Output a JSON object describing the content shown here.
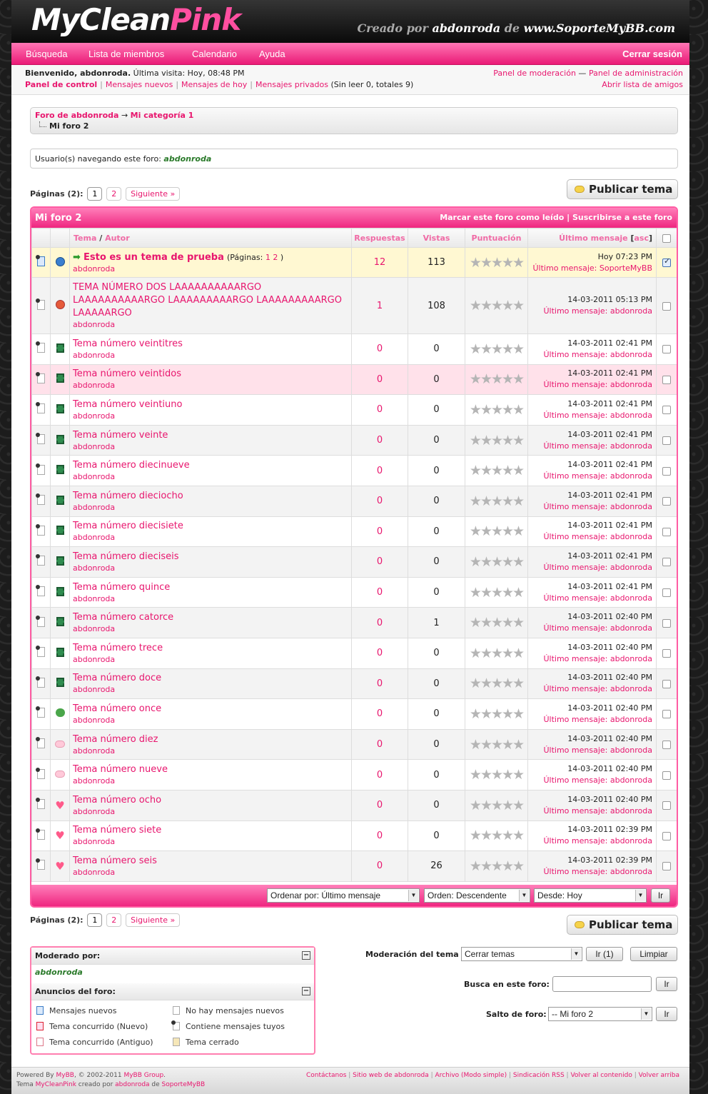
{
  "header": {
    "logo_a": "MyClean",
    "logo_b": "Pink",
    "credit_a": "Creado por ",
    "credit_user": "abdonroda",
    "credit_b": " de ",
    "credit_site": "www.SoporteMyBB.com"
  },
  "menu": {
    "items": [
      "Búsqueda",
      "Lista de miembros",
      "Calendario",
      "Ayuda"
    ],
    "logout": "Cerrar sesión"
  },
  "panel": {
    "welcome": "Bienvenido, abdonroda.",
    "last_visit": " Última visita: Hoy, 08:48 PM",
    "control": "Panel de control",
    "new_posts": "Mensajes nuevos",
    "today": "Mensajes de hoy",
    "pm": "Mensajes privados",
    "pm_counts": " (Sin leer 0, totales 9)",
    "mod_panel": "Panel de moderación",
    "dash": " — ",
    "admin_panel": "Panel de administración",
    "buddy": "Abrir lista de amigos"
  },
  "breadcrumb": {
    "forum": "Foro de abdonroda",
    "arrow": " → ",
    "cat": "Mi categoría 1",
    "current": "Mi foro 2"
  },
  "browsing": {
    "label": "Usuario(s) navegando este foro: ",
    "user": "abdonroda"
  },
  "pagination": {
    "label": "Páginas (2):",
    "p1": "1",
    "p2": "2",
    "next": "Siguiente »"
  },
  "post_button": "Publicar tema",
  "forum": {
    "title": "Mi foro 2",
    "mark_read": "Marcar este foro como leído",
    "sep": " | ",
    "subscribe": "Suscribirse a este foro"
  },
  "columns": {
    "thread": "Tema",
    "slash": " / ",
    "author": "Autor",
    "replies": "Respuestas",
    "views": "Vistas",
    "rating": "Puntuación",
    "last": "Último mensaje",
    "asc": "asc"
  },
  "threads": [
    {
      "title": "Esto es un tema de prueba",
      "pages_prefix": "(Páginas: ",
      "pg1": "1",
      "pg2": "2",
      "pages_suffix": " )",
      "author": "abdonroda",
      "replies": "12",
      "views": "113",
      "date": "Hoy 07:23 PM",
      "last_label": "Último mensaje: ",
      "last_user": "SoporteMyBB"
    },
    {
      "title": "TEMA NÚMERO DOS LAAAAAAAAAARGO LAAAAAAAAAARGO LAAAAAAAAARGO LAAAAAAAAARGO LAAAAARGO",
      "author": "abdonroda",
      "replies": "1",
      "views": "108",
      "date": "14-03-2011 05:13 PM",
      "last_label": "Último mensaje: ",
      "last_user": "abdonroda"
    },
    {
      "title": "Tema número veintitres",
      "author": "abdonroda",
      "replies": "0",
      "views": "0",
      "date": "14-03-2011 02:41 PM",
      "last_label": "Último mensaje: ",
      "last_user": "abdonroda"
    },
    {
      "title": "Tema número veintidos",
      "author": "abdonroda",
      "replies": "0",
      "views": "0",
      "date": "14-03-2011 02:41 PM",
      "last_label": "Último mensaje: ",
      "last_user": "abdonroda"
    },
    {
      "title": "Tema número veintiuno",
      "author": "abdonroda",
      "replies": "0",
      "views": "0",
      "date": "14-03-2011 02:41 PM",
      "last_label": "Último mensaje: ",
      "last_user": "abdonroda"
    },
    {
      "title": "Tema número veinte",
      "author": "abdonroda",
      "replies": "0",
      "views": "0",
      "date": "14-03-2011 02:41 PM",
      "last_label": "Último mensaje: ",
      "last_user": "abdonroda"
    },
    {
      "title": "Tema número diecinueve",
      "author": "abdonroda",
      "replies": "0",
      "views": "0",
      "date": "14-03-2011 02:41 PM",
      "last_label": "Último mensaje: ",
      "last_user": "abdonroda"
    },
    {
      "title": "Tema número dieciocho",
      "author": "abdonroda",
      "replies": "0",
      "views": "0",
      "date": "14-03-2011 02:41 PM",
      "last_label": "Último mensaje: ",
      "last_user": "abdonroda"
    },
    {
      "title": "Tema número diecisiete",
      "author": "abdonroda",
      "replies": "0",
      "views": "0",
      "date": "14-03-2011 02:41 PM",
      "last_label": "Último mensaje: ",
      "last_user": "abdonroda"
    },
    {
      "title": "Tema número dieciseis",
      "author": "abdonroda",
      "replies": "0",
      "views": "0",
      "date": "14-03-2011 02:41 PM",
      "last_label": "Último mensaje: ",
      "last_user": "abdonroda"
    },
    {
      "title": "Tema número quince",
      "author": "abdonroda",
      "replies": "0",
      "views": "0",
      "date": "14-03-2011 02:41 PM",
      "last_label": "Último mensaje: ",
      "last_user": "abdonroda"
    },
    {
      "title": "Tema número catorce",
      "author": "abdonroda",
      "replies": "0",
      "views": "1",
      "date": "14-03-2011 02:40 PM",
      "last_label": "Último mensaje: ",
      "last_user": "abdonroda"
    },
    {
      "title": "Tema número trece",
      "author": "abdonroda",
      "replies": "0",
      "views": "0",
      "date": "14-03-2011 02:40 PM",
      "last_label": "Último mensaje: ",
      "last_user": "abdonroda"
    },
    {
      "title": "Tema número doce",
      "author": "abdonroda",
      "replies": "0",
      "views": "0",
      "date": "14-03-2011 02:40 PM",
      "last_label": "Último mensaje: ",
      "last_user": "abdonroda"
    },
    {
      "title": "Tema número once",
      "author": "abdonroda",
      "replies": "0",
      "views": "0",
      "date": "14-03-2011 02:40 PM",
      "last_label": "Último mensaje: ",
      "last_user": "abdonroda"
    },
    {
      "title": "Tema número diez",
      "author": "abdonroda",
      "replies": "0",
      "views": "0",
      "date": "14-03-2011 02:40 PM",
      "last_label": "Último mensaje: ",
      "last_user": "abdonroda"
    },
    {
      "title": "Tema número nueve",
      "author": "abdonroda",
      "replies": "0",
      "views": "0",
      "date": "14-03-2011 02:40 PM",
      "last_label": "Último mensaje: ",
      "last_user": "abdonroda"
    },
    {
      "title": "Tema número ocho",
      "author": "abdonroda",
      "replies": "0",
      "views": "0",
      "date": "14-03-2011 02:40 PM",
      "last_label": "Último mensaje: ",
      "last_user": "abdonroda"
    },
    {
      "title": "Tema número siete",
      "author": "abdonroda",
      "replies": "0",
      "views": "0",
      "date": "14-03-2011 02:39 PM",
      "last_label": "Último mensaje: ",
      "last_user": "abdonroda"
    },
    {
      "title": "Tema número seis",
      "author": "abdonroda",
      "replies": "0",
      "views": "26",
      "date": "14-03-2011 02:39 PM",
      "last_label": "Último mensaje: ",
      "last_user": "abdonroda"
    }
  ],
  "sort": {
    "order_by": "Ordenar por: Último mensaje",
    "order": "Orden: Descendente",
    "from": "Desde: Hoy",
    "go": "Ir"
  },
  "moderators": {
    "title": "Moderado por:",
    "user": "abdonroda"
  },
  "legend": {
    "title": "Anuncios del foro:",
    "new": "Mensajes nuevos",
    "hot_new": "Tema concurrido (Nuevo)",
    "hot_old": "Tema concurrido (Antiguo)",
    "no_new": "No hay mensajes nuevos",
    "dot": "Contiene mensajes tuyos",
    "closed": "Tema cerrado"
  },
  "moderation": {
    "label": "Moderación del tema",
    "select": "Cerrar temas",
    "go": "Ir (1)",
    "clear": "Limpiar"
  },
  "search": {
    "label": "Busca en este foro:",
    "go": "Ir"
  },
  "jump": {
    "label": "Salto de foro:",
    "select": "-- Mi foro 2",
    "go": "Ir"
  },
  "footer": {
    "powered": "Powered By ",
    "mybb": "MyBB",
    "copy": ", © 2002-2011 ",
    "group": "MyBB Group",
    "dot": ".",
    "theme": "Tema ",
    "theme_name": "MyCleanPink",
    "by": " creado por ",
    "author": "abdonroda",
    "de": " de ",
    "site": "SoporteMyBB",
    "links": [
      "Contáctanos",
      "Sitio web de abdonroda",
      "Archivo (Modo simple)",
      "Sindicación RSS",
      "Volver al contenido",
      "Volver arriba"
    ]
  },
  "colors": {
    "accent": "#e8166e",
    "header_bg": "#111111",
    "menu_pink": "#f0368a"
  }
}
